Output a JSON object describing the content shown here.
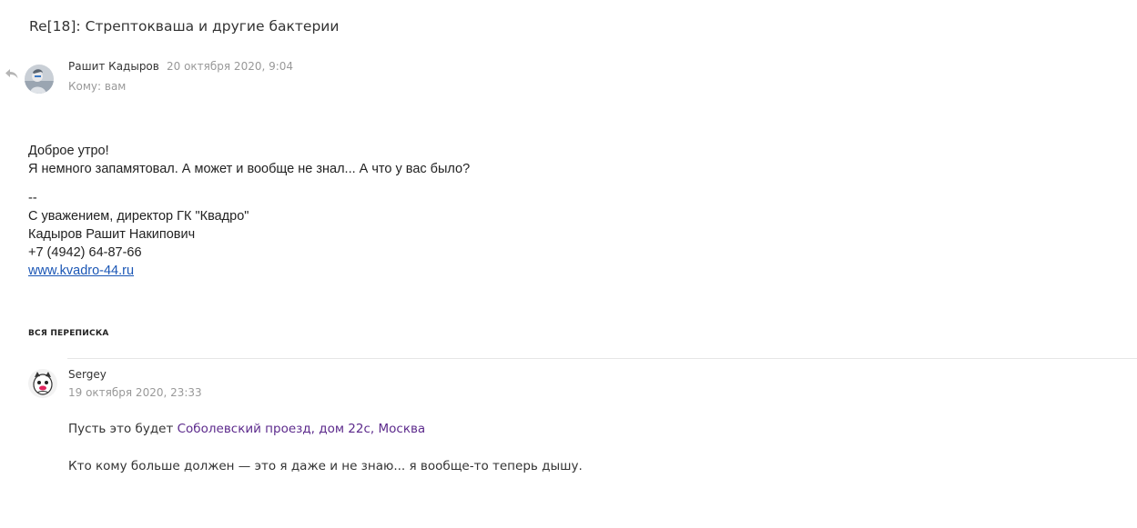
{
  "subject": "Re[18]: Стрептокваша и другие бактерии",
  "message": {
    "sender": "Рашит Кадыров",
    "date": "20 октября 2020, 9:04",
    "to": "Кому: вам",
    "body": {
      "greeting": "Доброе утро!",
      "line2": "Я немного запамятовал. А может и вообще не знал... А что у вас было?",
      "sig_sep": "--",
      "sig1": "С уважением, директор ГК \"Квадро\"",
      "sig2": "Кадыров Рашит Накипович",
      "phone": "+7 (4942) 64-87-66",
      "website": "www.kvadro-44.ru"
    }
  },
  "thread": {
    "header": "ВСЯ ПЕРЕПИСКА",
    "items": [
      {
        "sender": "Sergey",
        "date": "19 октября 2020, 23:33",
        "line1_prefix": "Пусть это будет ",
        "line1_link": "Соболевский проезд, дом 22с, Москва",
        "line2": "Кто кому больше должен — это я даже и не знаю... я вообще-то теперь дышу."
      }
    ]
  },
  "icons": {
    "reply": "reply-arrow-icon"
  },
  "colors": {
    "link": "#1a56b5",
    "address_link": "#5c2a8c",
    "muted": "#999999",
    "divider": "#e6e6e6"
  }
}
